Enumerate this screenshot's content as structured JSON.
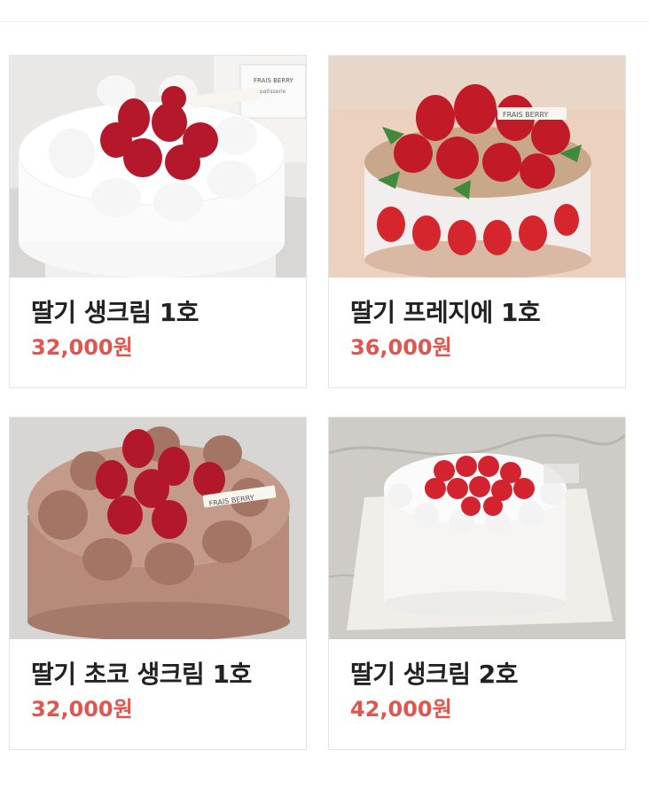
{
  "products": [
    {
      "title": "딸기 생크림 1호",
      "price": "32,000원",
      "photo": "strawberry-cream-cake-photo",
      "tag_text": "FRAIS BERRY",
      "tag_sub": "patisserie"
    },
    {
      "title": "딸기 프레지에 1호",
      "price": "36,000원",
      "photo": "strawberry-fraisier-cake-photo",
      "tag_text": "FRAIS BERRY"
    },
    {
      "title": "딸기 초코 생크림 1호",
      "price": "32,000원",
      "photo": "strawberry-choco-cream-cake-photo",
      "tag_text": "FRAIS BERRY"
    },
    {
      "title": "딸기 생크림 2호",
      "price": "42,000원",
      "photo": "strawberry-cream-cake-large-photo"
    }
  ],
  "colors": {
    "price": "#e0564f",
    "title": "#222222",
    "card_border": "#e3e3e3"
  }
}
